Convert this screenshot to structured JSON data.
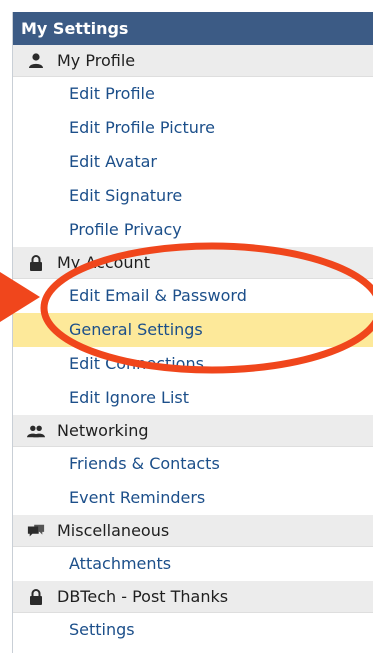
{
  "header": {
    "title": "My Settings"
  },
  "sections": [
    {
      "label": "My Profile",
      "icon": "user-icon",
      "items": [
        "Edit Profile",
        "Edit Profile Picture",
        "Edit Avatar",
        "Edit Signature",
        "Profile Privacy"
      ]
    },
    {
      "label": "My Account",
      "icon": "lock-icon",
      "items": [
        "Edit Email & Password",
        "General Settings",
        "Edit Connections",
        "Edit Ignore List"
      ]
    },
    {
      "label": "Networking",
      "icon": "people-icon",
      "items": [
        "Friends & Contacts",
        "Event Reminders"
      ]
    },
    {
      "label": "Miscellaneous",
      "icon": "chat-icon",
      "items": [
        "Attachments"
      ]
    },
    {
      "label": "DBTech - Post Thanks",
      "icon": "lock-icon",
      "items": [
        "Settings"
      ]
    }
  ],
  "highlighted_item": "General Settings",
  "colors": {
    "header_bg": "#3c5b85",
    "link": "#1c4f8a",
    "highlight": "#fde99a",
    "section_bg": "#ececec",
    "annotation": "#f0461c"
  }
}
